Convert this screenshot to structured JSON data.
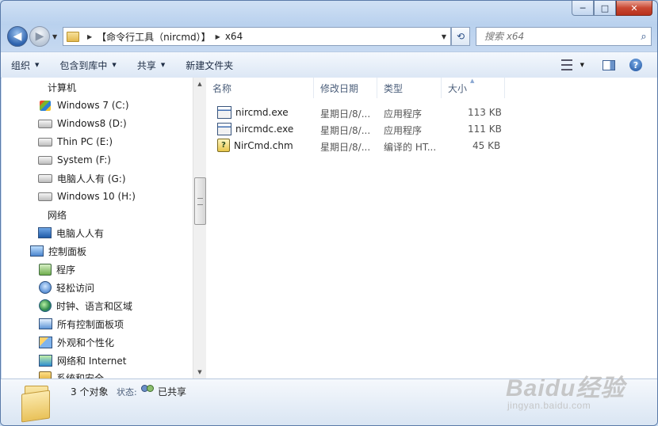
{
  "window": {
    "caption": {
      "minimize": "─",
      "maximize": "□",
      "close": "✕"
    }
  },
  "nav": {
    "back": "◀",
    "forward": "▶",
    "dropdown": "▼"
  },
  "address": {
    "crumbs": [
      "【命令行工具（nircmd）】",
      "x64"
    ],
    "separator": "▶",
    "dropdown": "▼"
  },
  "refresh": "⟲",
  "search": {
    "placeholder": "搜索 x64",
    "icon": "⌕"
  },
  "toolbar": {
    "organize": "组织",
    "include_in_library": "包含到库中",
    "share": "共享",
    "new_folder": "新建文件夹",
    "help": "?"
  },
  "tree": [
    {
      "label": "计算机",
      "icon": "computer-icon"
    },
    {
      "label": "Windows 7  (C:)",
      "icon": "windows-drive-icon"
    },
    {
      "label": "Windows8 (D:)",
      "icon": "drive-icon"
    },
    {
      "label": "Thin PC (E:)",
      "icon": "drive-icon"
    },
    {
      "label": "System (F:)",
      "icon": "drive-icon"
    },
    {
      "label": "电脑人人有 (G:)",
      "icon": "drive-icon"
    },
    {
      "label": "Windows 10 (H:)",
      "icon": "drive-icon"
    },
    {
      "label": "网络",
      "icon": "network-icon"
    },
    {
      "label": "电脑人人有",
      "icon": "network-computer-icon"
    },
    {
      "label": "控制面板",
      "icon": "control-panel-icon"
    },
    {
      "label": "程序",
      "icon": "programs-icon"
    },
    {
      "label": "轻松访问",
      "icon": "ease-of-access-icon"
    },
    {
      "label": "时钟、语言和区域",
      "icon": "clock-language-region-icon"
    },
    {
      "label": "所有控制面板项",
      "icon": "all-control-panel-items-icon"
    },
    {
      "label": "外观和个性化",
      "icon": "appearance-icon"
    },
    {
      "label": "网络和 Internet",
      "icon": "network-internet-icon"
    },
    {
      "label": "系统和安全",
      "icon": "system-security-icon"
    }
  ],
  "columns": {
    "name": "名称",
    "modified": "修改日期",
    "type": "类型",
    "size": "大小",
    "sort_indicator": "▲"
  },
  "files": [
    {
      "name": "nircmd.exe",
      "modified": "星期日/8/...",
      "type": "应用程序",
      "size": "113 KB",
      "icon": "exe-icon"
    },
    {
      "name": "nircmdc.exe",
      "modified": "星期日/8/...",
      "type": "应用程序",
      "size": "111 KB",
      "icon": "exe-icon"
    },
    {
      "name": "NirCmd.chm",
      "modified": "星期日/8/...",
      "type": "编译的 HT...",
      "size": "45 KB",
      "icon": "chm-help-icon"
    }
  ],
  "status": {
    "count": "3 个对象",
    "state_label": "状态:",
    "state_value": "已共享"
  },
  "watermark": {
    "text": "Baidu经验",
    "url": "jingyan.baidu.com"
  }
}
